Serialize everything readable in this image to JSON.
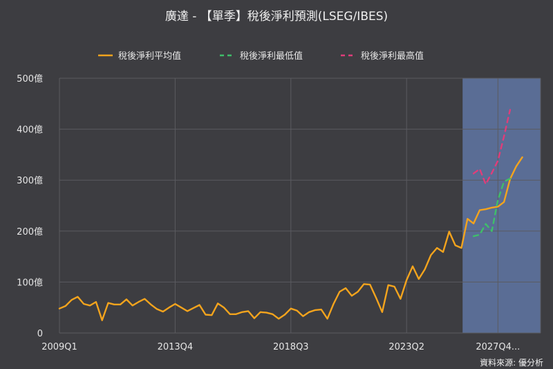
{
  "chart_data": {
    "type": "line",
    "title": "廣達 - 【單季】稅後淨利預測(LSEG/IBES)",
    "source": "資料來源: 優分析",
    "x_start": {
      "year": 2009,
      "quarter": 1
    },
    "xtick_labels": [
      "2009Q1",
      "2013Q4",
      "2018Q3",
      "2023Q2",
      "2027Q4..."
    ],
    "xtick_index": [
      0,
      19,
      38,
      57,
      72
    ],
    "yticks": [
      0,
      100,
      200,
      300,
      400,
      500
    ],
    "ytick_labels": [
      "0",
      "100億",
      "200億",
      "300億",
      "400億",
      "500億"
    ],
    "ylim": [
      0,
      500
    ],
    "grid": true,
    "legend_position": "top-center",
    "forecast_shade": {
      "from_quarter": "2026Q1",
      "to_quarter": "2028Q4",
      "color": "#5a6d95"
    },
    "series": [
      {
        "name": "稅後淨利平均值",
        "color": "#f4a41d",
        "dash": "solid",
        "start_quarter": "2009Q1",
        "values": [
          48,
          53,
          65,
          71,
          57,
          54,
          61,
          25,
          59,
          56,
          56,
          66,
          54,
          61,
          67,
          56,
          47,
          42,
          50,
          57,
          50,
          43,
          49,
          55,
          36,
          35,
          58,
          50,
          37,
          37,
          41,
          43,
          29,
          41,
          40,
          37,
          28,
          36,
          48,
          44,
          33,
          41,
          45,
          46,
          28,
          57,
          81,
          88,
          73,
          81,
          96,
          95,
          69,
          41,
          94,
          91,
          67,
          104,
          131,
          106,
          125,
          153,
          167,
          159,
          199,
          172,
          167,
          224,
          215,
          241,
          243,
          246,
          248,
          257,
          302,
          327,
          345
        ]
      },
      {
        "name": "稅後淨利最低值",
        "color": "#3fbf6a",
        "dash": "dashed",
        "start_quarter": "2026Q1",
        "values": [
          190,
          193,
          214,
          200,
          261,
          297,
          303
        ]
      },
      {
        "name": "稅後淨利最高值",
        "color": "#e03d7a",
        "dash": "dashed",
        "start_quarter": "2026Q1",
        "values": [
          313,
          322,
          292,
          314,
          338,
          386,
          438
        ]
      }
    ]
  }
}
